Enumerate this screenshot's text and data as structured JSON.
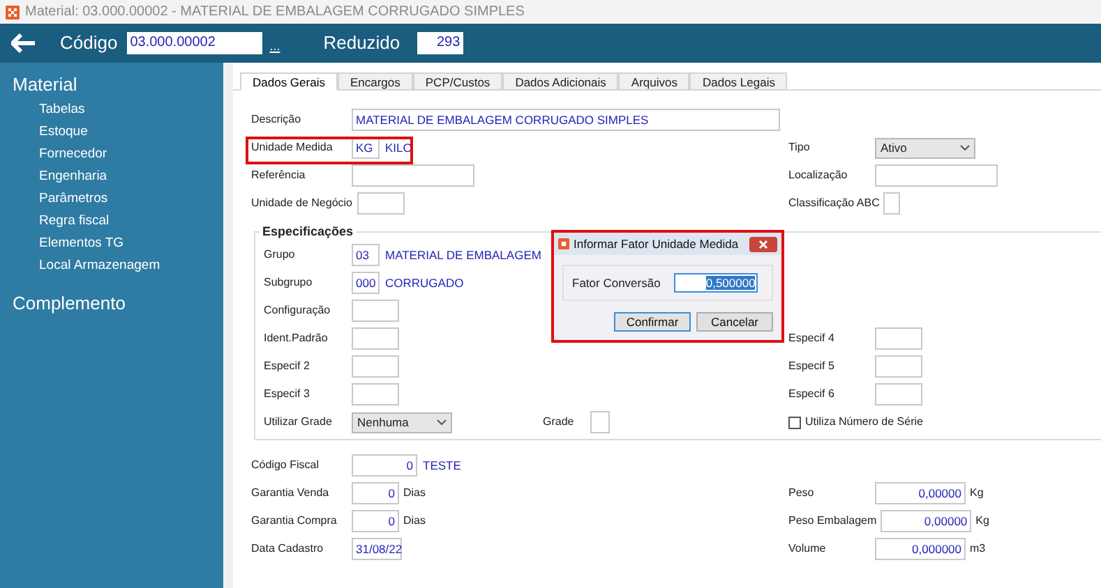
{
  "window": {
    "title": "Material: 03.000.00002 - MATERIAL DE EMBALAGEM CORRUGADO SIMPLES"
  },
  "header": {
    "code_label": "Código",
    "code_value": "03.000.00002",
    "lookup": "...",
    "reduced_label": "Reduzido",
    "reduced_value": "293"
  },
  "sidebar": {
    "sections": [
      {
        "title": "Material",
        "items": [
          "Tabelas",
          "Estoque",
          "Fornecedor",
          "Engenharia",
          "Parâmetros",
          "Regra fiscal",
          "Elementos TG",
          "Local Armazenagem"
        ]
      },
      {
        "title": "Complemento"
      }
    ]
  },
  "tabs": [
    {
      "label": "Dados Gerais",
      "selected": true
    },
    {
      "label": "Encargos",
      "selected": false
    },
    {
      "label": "PCP/Custos",
      "selected": false
    },
    {
      "label": "Dados Adicionais",
      "selected": false
    },
    {
      "label": "Arquivos",
      "selected": false
    },
    {
      "label": "Dados Legais",
      "selected": false
    }
  ],
  "general_rows": [
    {
      "left": {
        "label": "Descrição",
        "kind": "wide",
        "value": "MATERIAL DE EMBALAGEM CORRUGADO SIMPLES"
      }
    },
    {
      "left": {
        "label": "Unidade Medida",
        "kind": "code",
        "value": "KG",
        "note": "KILO",
        "highlighted": true
      },
      "right": {
        "label": "Tipo",
        "kind": "select",
        "value": "Ativo"
      }
    },
    {
      "left": {
        "label": "Referência",
        "kind": "medium"
      },
      "right": {
        "label": "Localização",
        "kind": "medium"
      }
    },
    {
      "left": {
        "label": "Unidade de Negócio",
        "kind": "small"
      },
      "right": {
        "label": "Classificação ABC",
        "kind": "tiny"
      }
    }
  ],
  "specifications": {
    "title": "Especificações",
    "rows": [
      {
        "left": {
          "label": "Grupo",
          "kind": "code",
          "value": "03",
          "note": "MATERIAL DE EMBALAGEM"
        }
      },
      {
        "left": {
          "label": "Subgrupo",
          "kind": "code",
          "value": "000",
          "note": "CORRUGADO"
        }
      },
      {
        "left": {
          "label": "Configuração",
          "kind": "small"
        }
      },
      {
        "left": {
          "label": "Ident.Padrão",
          "kind": "small"
        },
        "right": {
          "label": "Especif 4",
          "kind": "small"
        }
      },
      {
        "left": {
          "label": "Especif 2",
          "kind": "small"
        },
        "right": {
          "label": "Especif 5",
          "kind": "small"
        }
      },
      {
        "left": {
          "label": "Especif 3",
          "kind": "small"
        },
        "right": {
          "label": "Especif 6",
          "kind": "small"
        }
      },
      {
        "left": {
          "label": "Utilizar Grade",
          "kind": "select",
          "value": "Nenhuma"
        },
        "middle": {
          "label": "Grade",
          "kind": "disabled"
        },
        "right": {
          "label": "Utiliza Número de Série",
          "kind": "checkbox",
          "checked": false
        }
      }
    ]
  },
  "bottom_rows": [
    {
      "left": {
        "label": "Código Fiscal",
        "kind": "number_medium",
        "value": "0",
        "note": "TESTE"
      }
    },
    {
      "left": {
        "label": "Garantia Venda",
        "kind": "number",
        "value": "0",
        "unit": "Dias"
      },
      "right": {
        "label": "Peso",
        "kind": "number_wide",
        "value": "0,00000",
        "unit": "Kg"
      }
    },
    {
      "left": {
        "label": "Garantia Compra",
        "kind": "number",
        "value": "0",
        "unit": "Dias"
      },
      "right": {
        "label": "Peso Embalagem",
        "kind": "number_wide",
        "value": "0,00000",
        "unit": "Kg"
      }
    },
    {
      "left": {
        "label": "Data Cadastro",
        "kind": "date",
        "value": "31/08/22"
      },
      "right": {
        "label": "Volume",
        "kind": "number_wide",
        "value": "0,000000",
        "unit": "m3"
      }
    }
  ],
  "dialog": {
    "title": "Informar Fator Unidade Medida",
    "field_label": "Fator Conversão",
    "field_value": "0,500000",
    "value_selected": true,
    "buttons": [
      {
        "label": "Confirmar",
        "default": true
      },
      {
        "label": "Cancelar",
        "default": false
      }
    ]
  }
}
